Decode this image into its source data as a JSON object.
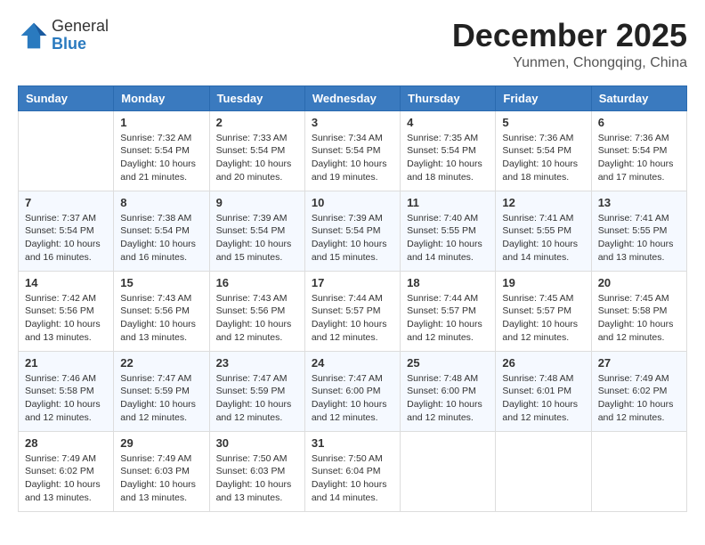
{
  "logo": {
    "general": "General",
    "blue": "Blue"
  },
  "title": "December 2025",
  "location": "Yunmen, Chongqing, China",
  "days_of_week": [
    "Sunday",
    "Monday",
    "Tuesday",
    "Wednesday",
    "Thursday",
    "Friday",
    "Saturday"
  ],
  "weeks": [
    [
      {
        "num": "",
        "sunrise": "",
        "sunset": "",
        "daylight": ""
      },
      {
        "num": "1",
        "sunrise": "Sunrise: 7:32 AM",
        "sunset": "Sunset: 5:54 PM",
        "daylight": "Daylight: 10 hours and 21 minutes."
      },
      {
        "num": "2",
        "sunrise": "Sunrise: 7:33 AM",
        "sunset": "Sunset: 5:54 PM",
        "daylight": "Daylight: 10 hours and 20 minutes."
      },
      {
        "num": "3",
        "sunrise": "Sunrise: 7:34 AM",
        "sunset": "Sunset: 5:54 PM",
        "daylight": "Daylight: 10 hours and 19 minutes."
      },
      {
        "num": "4",
        "sunrise": "Sunrise: 7:35 AM",
        "sunset": "Sunset: 5:54 PM",
        "daylight": "Daylight: 10 hours and 18 minutes."
      },
      {
        "num": "5",
        "sunrise": "Sunrise: 7:36 AM",
        "sunset": "Sunset: 5:54 PM",
        "daylight": "Daylight: 10 hours and 18 minutes."
      },
      {
        "num": "6",
        "sunrise": "Sunrise: 7:36 AM",
        "sunset": "Sunset: 5:54 PM",
        "daylight": "Daylight: 10 hours and 17 minutes."
      }
    ],
    [
      {
        "num": "7",
        "sunrise": "Sunrise: 7:37 AM",
        "sunset": "Sunset: 5:54 PM",
        "daylight": "Daylight: 10 hours and 16 minutes."
      },
      {
        "num": "8",
        "sunrise": "Sunrise: 7:38 AM",
        "sunset": "Sunset: 5:54 PM",
        "daylight": "Daylight: 10 hours and 16 minutes."
      },
      {
        "num": "9",
        "sunrise": "Sunrise: 7:39 AM",
        "sunset": "Sunset: 5:54 PM",
        "daylight": "Daylight: 10 hours and 15 minutes."
      },
      {
        "num": "10",
        "sunrise": "Sunrise: 7:39 AM",
        "sunset": "Sunset: 5:54 PM",
        "daylight": "Daylight: 10 hours and 15 minutes."
      },
      {
        "num": "11",
        "sunrise": "Sunrise: 7:40 AM",
        "sunset": "Sunset: 5:55 PM",
        "daylight": "Daylight: 10 hours and 14 minutes."
      },
      {
        "num": "12",
        "sunrise": "Sunrise: 7:41 AM",
        "sunset": "Sunset: 5:55 PM",
        "daylight": "Daylight: 10 hours and 14 minutes."
      },
      {
        "num": "13",
        "sunrise": "Sunrise: 7:41 AM",
        "sunset": "Sunset: 5:55 PM",
        "daylight": "Daylight: 10 hours and 13 minutes."
      }
    ],
    [
      {
        "num": "14",
        "sunrise": "Sunrise: 7:42 AM",
        "sunset": "Sunset: 5:56 PM",
        "daylight": "Daylight: 10 hours and 13 minutes."
      },
      {
        "num": "15",
        "sunrise": "Sunrise: 7:43 AM",
        "sunset": "Sunset: 5:56 PM",
        "daylight": "Daylight: 10 hours and 13 minutes."
      },
      {
        "num": "16",
        "sunrise": "Sunrise: 7:43 AM",
        "sunset": "Sunset: 5:56 PM",
        "daylight": "Daylight: 10 hours and 12 minutes."
      },
      {
        "num": "17",
        "sunrise": "Sunrise: 7:44 AM",
        "sunset": "Sunset: 5:57 PM",
        "daylight": "Daylight: 10 hours and 12 minutes."
      },
      {
        "num": "18",
        "sunrise": "Sunrise: 7:44 AM",
        "sunset": "Sunset: 5:57 PM",
        "daylight": "Daylight: 10 hours and 12 minutes."
      },
      {
        "num": "19",
        "sunrise": "Sunrise: 7:45 AM",
        "sunset": "Sunset: 5:57 PM",
        "daylight": "Daylight: 10 hours and 12 minutes."
      },
      {
        "num": "20",
        "sunrise": "Sunrise: 7:45 AM",
        "sunset": "Sunset: 5:58 PM",
        "daylight": "Daylight: 10 hours and 12 minutes."
      }
    ],
    [
      {
        "num": "21",
        "sunrise": "Sunrise: 7:46 AM",
        "sunset": "Sunset: 5:58 PM",
        "daylight": "Daylight: 10 hours and 12 minutes."
      },
      {
        "num": "22",
        "sunrise": "Sunrise: 7:47 AM",
        "sunset": "Sunset: 5:59 PM",
        "daylight": "Daylight: 10 hours and 12 minutes."
      },
      {
        "num": "23",
        "sunrise": "Sunrise: 7:47 AM",
        "sunset": "Sunset: 5:59 PM",
        "daylight": "Daylight: 10 hours and 12 minutes."
      },
      {
        "num": "24",
        "sunrise": "Sunrise: 7:47 AM",
        "sunset": "Sunset: 6:00 PM",
        "daylight": "Daylight: 10 hours and 12 minutes."
      },
      {
        "num": "25",
        "sunrise": "Sunrise: 7:48 AM",
        "sunset": "Sunset: 6:00 PM",
        "daylight": "Daylight: 10 hours and 12 minutes."
      },
      {
        "num": "26",
        "sunrise": "Sunrise: 7:48 AM",
        "sunset": "Sunset: 6:01 PM",
        "daylight": "Daylight: 10 hours and 12 minutes."
      },
      {
        "num": "27",
        "sunrise": "Sunrise: 7:49 AM",
        "sunset": "Sunset: 6:02 PM",
        "daylight": "Daylight: 10 hours and 12 minutes."
      }
    ],
    [
      {
        "num": "28",
        "sunrise": "Sunrise: 7:49 AM",
        "sunset": "Sunset: 6:02 PM",
        "daylight": "Daylight: 10 hours and 13 minutes."
      },
      {
        "num": "29",
        "sunrise": "Sunrise: 7:49 AM",
        "sunset": "Sunset: 6:03 PM",
        "daylight": "Daylight: 10 hours and 13 minutes."
      },
      {
        "num": "30",
        "sunrise": "Sunrise: 7:50 AM",
        "sunset": "Sunset: 6:03 PM",
        "daylight": "Daylight: 10 hours and 13 minutes."
      },
      {
        "num": "31",
        "sunrise": "Sunrise: 7:50 AM",
        "sunset": "Sunset: 6:04 PM",
        "daylight": "Daylight: 10 hours and 14 minutes."
      },
      {
        "num": "",
        "sunrise": "",
        "sunset": "",
        "daylight": ""
      },
      {
        "num": "",
        "sunrise": "",
        "sunset": "",
        "daylight": ""
      },
      {
        "num": "",
        "sunrise": "",
        "sunset": "",
        "daylight": ""
      }
    ]
  ]
}
